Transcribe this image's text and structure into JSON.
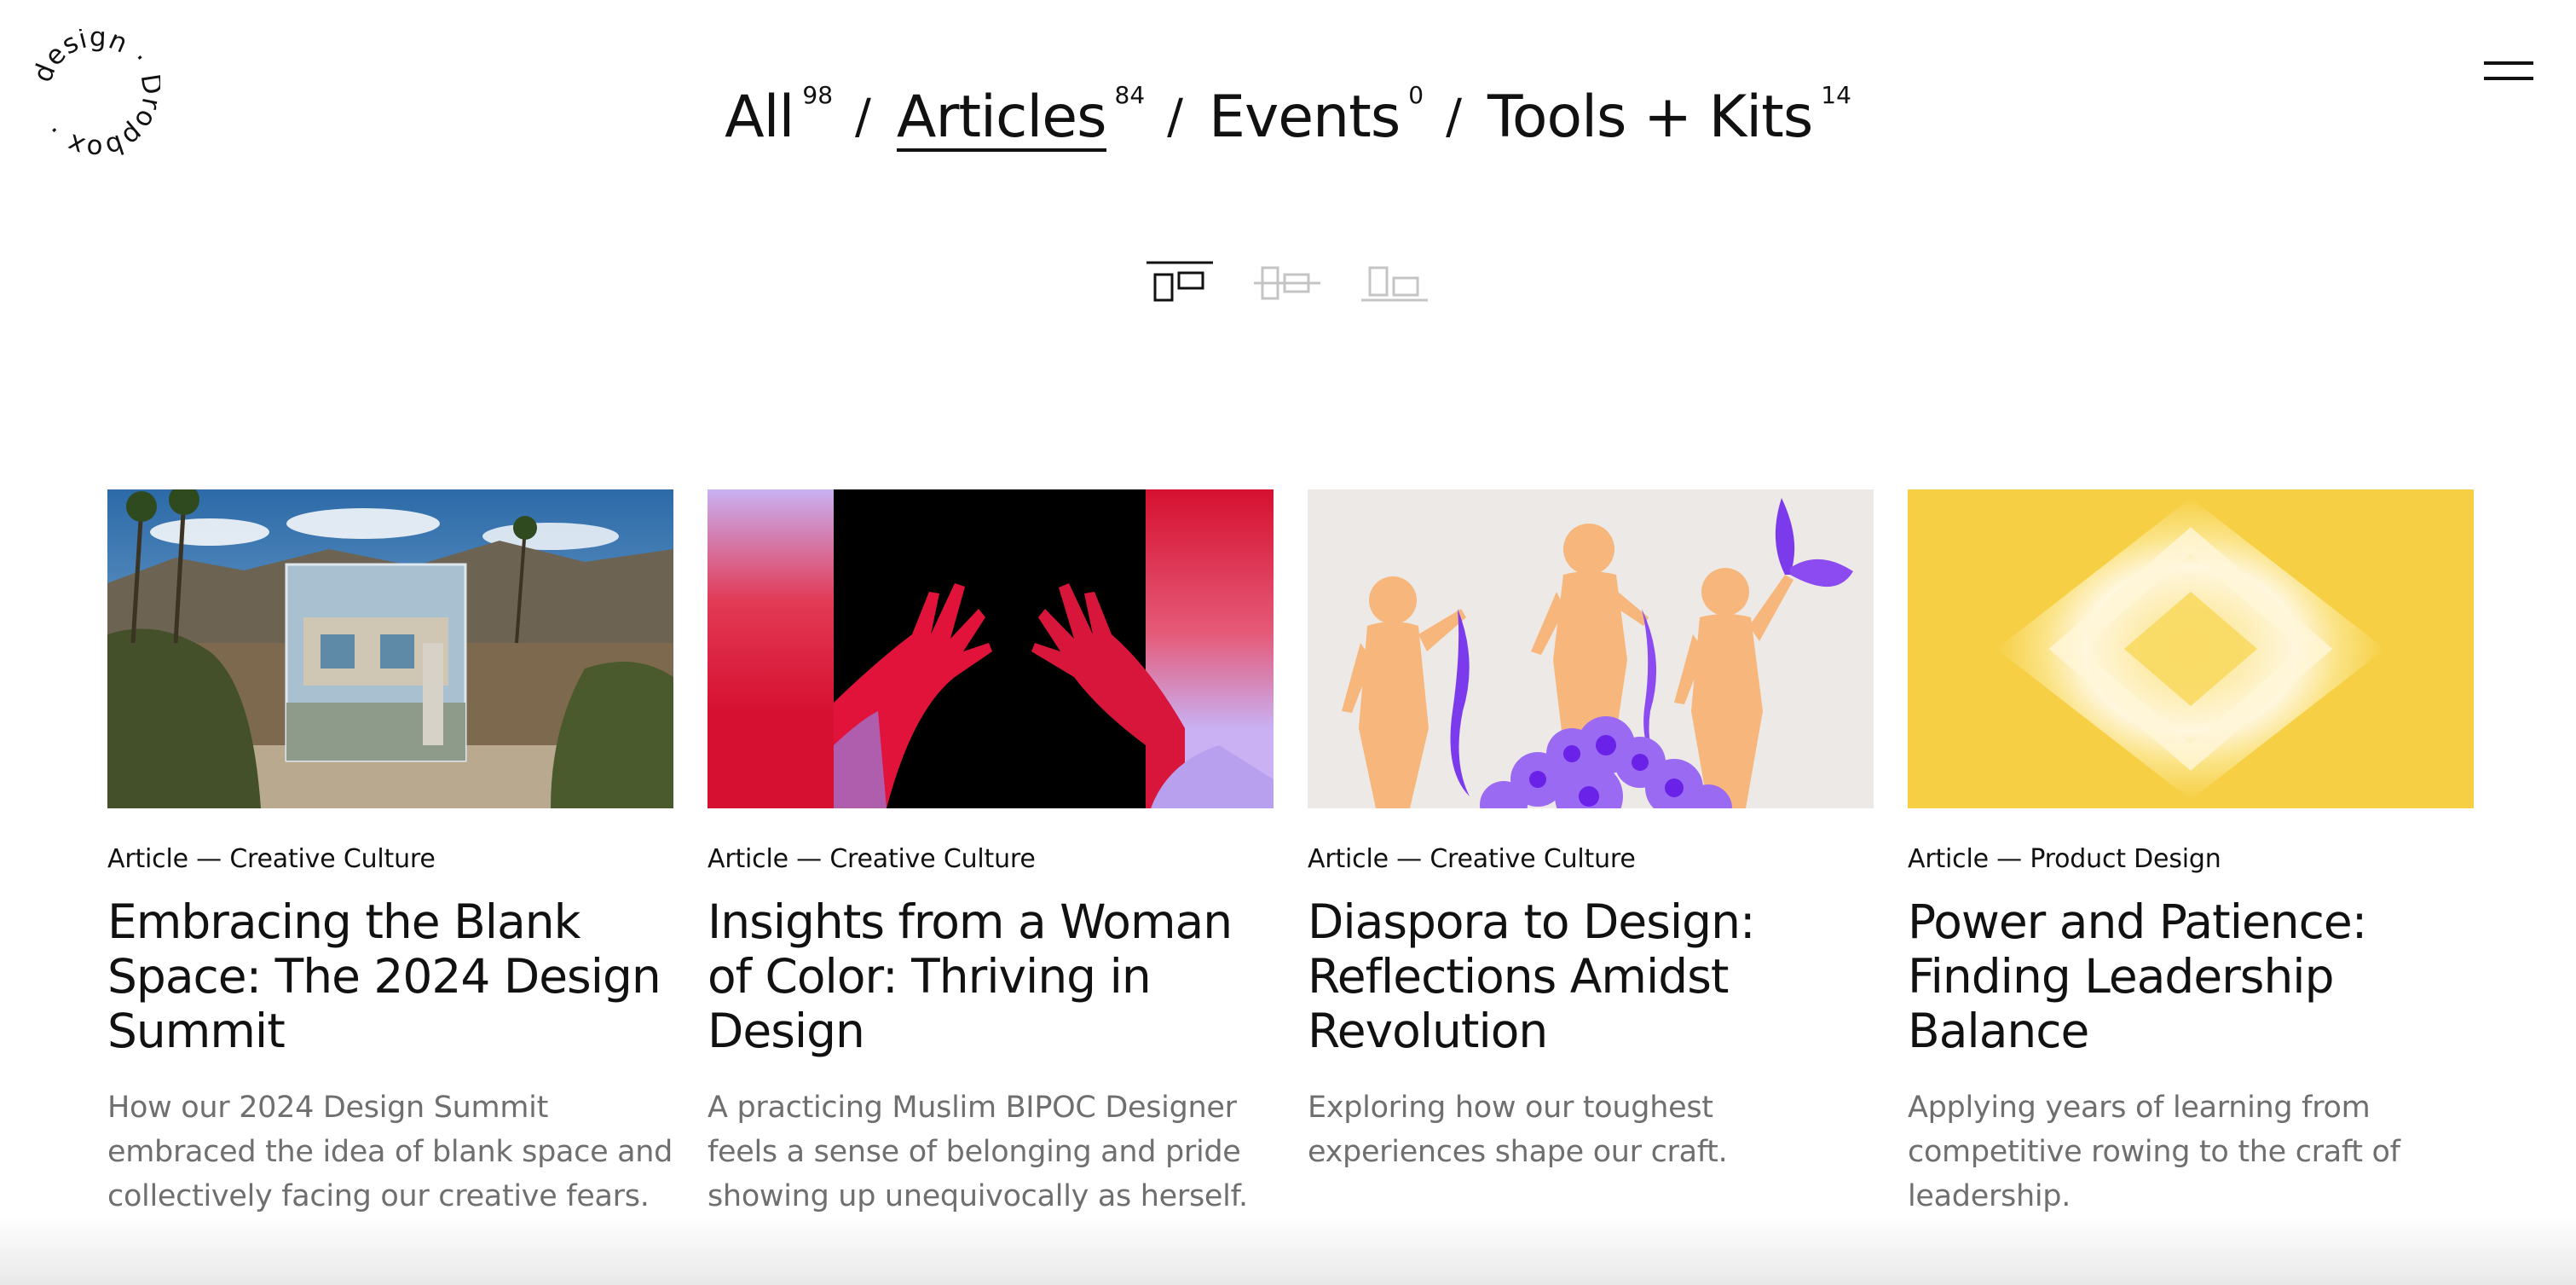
{
  "logo": {
    "text": "design · Dropbox ·"
  },
  "filters": [
    {
      "label": "All",
      "count": "98",
      "active": false
    },
    {
      "label": "Articles",
      "count": "84",
      "active": true
    },
    {
      "label": "Events",
      "count": "0",
      "active": false
    },
    {
      "label": "Tools + Kits",
      "count": "14",
      "active": false
    }
  ],
  "separator": "/",
  "view_icons": [
    "layout-featured-icon",
    "layout-list-icon",
    "layout-grid-icon"
  ],
  "cards": [
    {
      "meta": "Article — Creative Culture",
      "title": "Embracing the Blank Space: The 2024 Design Summit",
      "description": "How our 2024 Design Summit embraced the idea of blank space and collectively facing our creative fears.",
      "image": "desert-mirror-installation"
    },
    {
      "meta": "Article — Creative Culture",
      "title": "Insights from a Woman of Color: Thriving in Design",
      "description": "A practicing Muslim BIPOC Designer feels a sense of belonging and pride showing up unequivocally as herself.",
      "image": "reaching-hands"
    },
    {
      "meta": "Article — Creative Culture",
      "title": "Diaspora to Design: Reflections Amidst Revolution",
      "description": "Exploring how our toughest experiences shape our craft.",
      "image": "children-with-flags"
    },
    {
      "meta": "Article — Product Design",
      "title": "Power and Patience: Finding Leadership Balance",
      "description": "Applying years of learning from competitive rowing to the craft of leadership.",
      "image": "yellow-pixel-diamond"
    }
  ],
  "colors": {
    "text": "#111111",
    "muted": "#6f6f6f",
    "yellow": "#f6cf44",
    "purple": "#7c3aed",
    "red": "#d90f2d",
    "lavender": "#c8b3f2"
  }
}
